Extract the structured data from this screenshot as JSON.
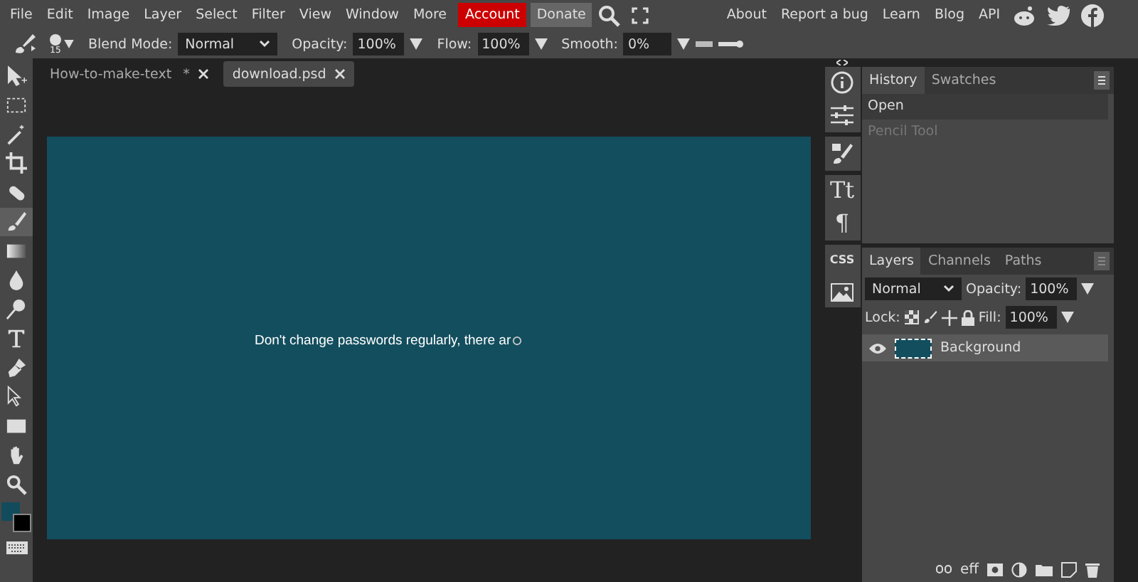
{
  "menu": [
    {
      "label": "File",
      "kind": "plain"
    },
    {
      "label": "Edit",
      "kind": "plain"
    },
    {
      "label": "Image",
      "kind": "plain"
    },
    {
      "label": "Layer",
      "kind": "plain"
    },
    {
      "label": "Select",
      "kind": "plain"
    },
    {
      "label": "Filter",
      "kind": "plain"
    },
    {
      "label": "View",
      "kind": "plain"
    },
    {
      "label": "Window",
      "kind": "plain"
    },
    {
      "label": "More",
      "kind": "plain"
    },
    {
      "label": "Account",
      "kind": "account"
    },
    {
      "label": "Donate",
      "kind": "donate"
    }
  ],
  "links": [
    "About",
    "Report a bug",
    "Learn",
    "Blog",
    "API"
  ],
  "options": {
    "brush_size": "15",
    "blend_label": "Blend Mode:",
    "blend_value": "Normal",
    "opacity_label": "Opacity:",
    "opacity_value": "100%",
    "flow_label": "Flow:",
    "flow_value": "100%",
    "smooth_label": "Smooth:",
    "smooth_value": "0%"
  },
  "tools": [
    {
      "kind": "move",
      "selected": false
    },
    {
      "kind": "marquee",
      "selected": false
    },
    {
      "kind": "wand",
      "selected": false
    },
    {
      "kind": "crop",
      "selected": false
    },
    {
      "kind": "heal",
      "selected": false
    },
    {
      "kind": "brush",
      "selected": true
    },
    {
      "kind": "gradient",
      "selected": false
    },
    {
      "kind": "blur",
      "selected": false
    },
    {
      "kind": "dodge",
      "selected": false
    },
    {
      "kind": "type",
      "selected": false
    },
    {
      "kind": "pen",
      "selected": false
    },
    {
      "kind": "path-select",
      "selected": false
    },
    {
      "kind": "shape",
      "selected": false
    },
    {
      "kind": "hand",
      "selected": false
    },
    {
      "kind": "zoom",
      "selected": false
    }
  ],
  "color_swatches": [
    {
      "kind": "foreground",
      "color": "#124c5c"
    },
    {
      "kind": "background",
      "color": "#000000"
    }
  ],
  "doc_tabs": [
    {
      "label": "How-to-make-text",
      "modified": "*",
      "selected": false
    },
    {
      "label": "download.psd",
      "selected": true
    }
  ],
  "canvas": {
    "color": "#134e5e",
    "text": "Don't change passwords regularly, there ar"
  },
  "side_icons": [
    {
      "kind": "info"
    },
    {
      "kind": "sliders"
    },
    {
      "kind": "brush"
    },
    {
      "kind": "text",
      "label": "Tt"
    },
    {
      "kind": "text",
      "label": "¶"
    },
    {
      "kind": "text",
      "label": "CSS"
    },
    {
      "kind": "image"
    }
  ],
  "history": {
    "tabs": [
      {
        "label": "History",
        "selected": true
      },
      {
        "label": "Swatches",
        "selected": false
      }
    ],
    "items": [
      {
        "label": "Open",
        "selected": true,
        "disabled": false
      },
      {
        "label": "Pencil Tool",
        "selected": false,
        "disabled": true
      }
    ]
  },
  "layers": {
    "tabs": [
      {
        "label": "Layers",
        "selected": true
      },
      {
        "label": "Channels",
        "selected": false
      },
      {
        "label": "Paths",
        "selected": false
      }
    ],
    "blend": "Normal",
    "opacity_label": "Opacity:",
    "opacity": "100%",
    "lock_label": "Lock:",
    "fill_label": "Fill:",
    "fill": "100%",
    "items": [
      {
        "name": "Background",
        "visible": true,
        "selected": true,
        "color": "#134e5e"
      }
    ],
    "footer_text": "eff"
  }
}
